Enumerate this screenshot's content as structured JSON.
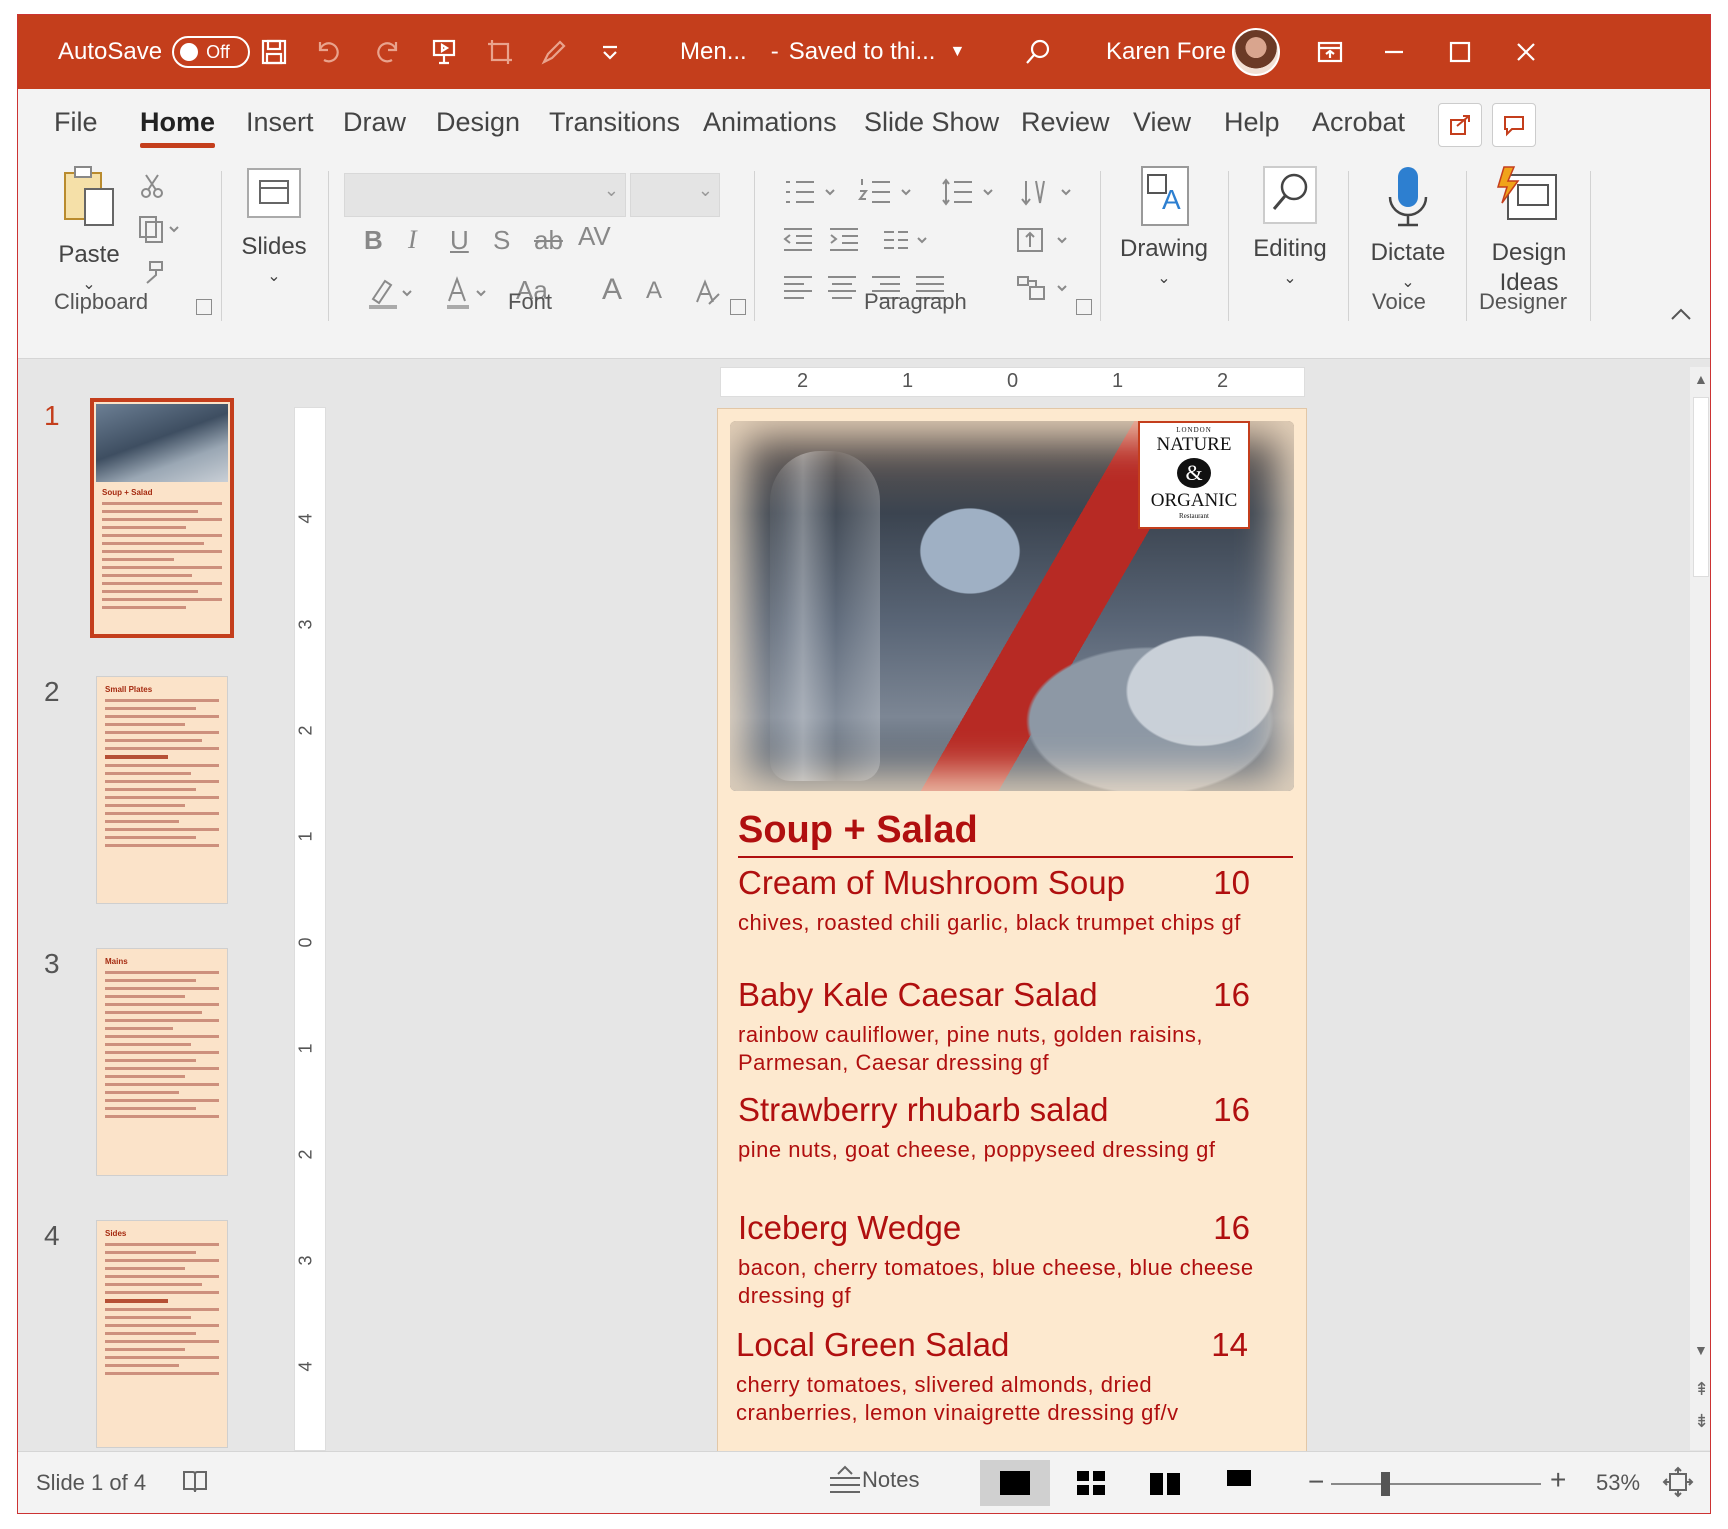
{
  "titlebar": {
    "autosave_label": "AutoSave",
    "autosave_state": "Off",
    "doc_name": "Men...",
    "separator": "-",
    "save_status": "Saved to thi...",
    "user_name": "Karen Fore"
  },
  "tabs": [
    "File",
    "Home",
    "Insert",
    "Draw",
    "Design",
    "Transitions",
    "Animations",
    "Slide Show",
    "Review",
    "View",
    "Help",
    "Acrobat"
  ],
  "ribbon": {
    "paste": "Paste",
    "slides": "Slides",
    "drawing": "Drawing",
    "editing": "Editing",
    "dictate": "Dictate",
    "design_ideas_1": "Design",
    "design_ideas_2": "Ideas",
    "groups": {
      "clipboard": "Clipboard",
      "font": "Font",
      "paragraph": "Paragraph",
      "voice": "Voice",
      "designer": "Designer"
    },
    "font_buttons": {
      "bold": "B",
      "italic": "I",
      "underline": "U",
      "shadow": "S",
      "strike": "ab",
      "spacing": "AV",
      "case": "Aa",
      "grow": "A",
      "shrink": "A"
    }
  },
  "thumbnails": {
    "numbers": [
      "1",
      "2",
      "3",
      "4"
    ],
    "slide1": {
      "heading": "Soup + Salad"
    },
    "slide2": {
      "heading": "Small Plates"
    },
    "slide3": {
      "heading": "Mains"
    },
    "slide4": {
      "heading": "Sides"
    }
  },
  "rulers": {
    "horizontal": [
      "2",
      "1",
      "0",
      "1",
      "2"
    ],
    "vertical": [
      "4",
      "3",
      "2",
      "1",
      "0",
      "1",
      "2",
      "3",
      "4"
    ]
  },
  "slide": {
    "logo": {
      "top": "LONDON",
      "line1": "NATURE",
      "amp": "&",
      "line2": "ORGANIC",
      "bottom": "Restaurant"
    },
    "section_title": "Soup + Salad",
    "items": [
      {
        "name": "Cream of Mushroom Soup",
        "price": "10",
        "desc": "chives, roasted chili garlic, black trumpet chips gf"
      },
      {
        "name": "Baby Kale Caesar Salad",
        "price": "16",
        "desc": "rainbow cauliflower, pine nuts, golden raisins, Parmesan, Caesar dressing gf"
      },
      {
        "name": "Strawberry rhubarb salad",
        "price": "16",
        "desc": "pine nuts, goat cheese, poppyseed dressing gf"
      },
      {
        "name": "Iceberg Wedge",
        "price": "16",
        "desc": "bacon, cherry tomatoes, blue cheese, blue cheese dressing gf"
      },
      {
        "name": "Local Green Salad",
        "price": "14",
        "desc": "cherry tomatoes, slivered almonds, dried cranberries, lemon vinaigrette dressing gf/v"
      }
    ]
  },
  "statusbar": {
    "slide_info": "Slide 1 of 4",
    "notes": "Notes",
    "zoom_minus": "−",
    "zoom_plus": "+",
    "zoom_level": "53%"
  },
  "colors": {
    "accent": "#c43e1c",
    "menu_red": "#b00f0f",
    "slide_bg": "#fde9cf"
  }
}
